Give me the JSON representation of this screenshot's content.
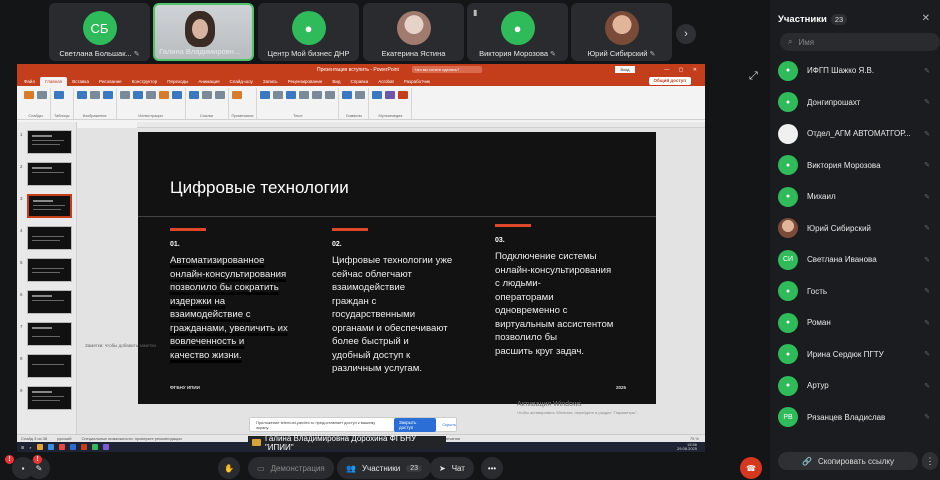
{
  "tiles": [
    {
      "initials": "СБ",
      "name": "Светлана Большак...",
      "muted": true
    },
    {
      "initials": "",
      "name": "Галина Владимировн...",
      "muted": true,
      "video": true
    },
    {
      "initials": "",
      "name": "Центр Мой бизнес ДНР",
      "muted": false
    },
    {
      "initials": "",
      "name": "Екатерина Ястина",
      "muted": false
    },
    {
      "initials": "",
      "name": "Виктория Морозова",
      "muted": true
    },
    {
      "initials": "",
      "name": "Юрий Сибирский",
      "muted": true
    }
  ],
  "icons": {
    "mute": "✎",
    "next": "›",
    "expand": "⤢"
  },
  "ppt": {
    "title": "Презентация вступить - PowerPoint",
    "search": "Что вы хотите сделать?",
    "login": "Вход",
    "tabs": [
      "Файл",
      "Главная",
      "Вставка",
      "Рисование",
      "Конструктор",
      "Переходы",
      "Анимация",
      "Слайд-шоу",
      "Запись",
      "Рецензирование",
      "Вид",
      "Справка",
      "Acrobat",
      "Разработчик"
    ],
    "active_tab": "Вставка",
    "share_btn": "Общий доступ",
    "groups": [
      "Слайды",
      "Таблицы",
      "Изображения",
      "Иллюстрации",
      "Ссылки",
      "Примечания",
      "Текст",
      "Символы",
      "Мультимедиа"
    ],
    "notes": "Заметки: чтобы добавить заметки",
    "status_left": "Слайд 3 из 38",
    "status_lang": "русский",
    "status_access": "Специальные возможности: проверьте рекомендации",
    "status_notes": "Заметки",
    "status_comments": "Примечания",
    "zoom": "75 %",
    "clock_time": "15:56",
    "clock_date": "29.08.2025",
    "popup_text": "Приложение telemost.yandex.ru предоставляет доступ к вашему экрану.",
    "popup_button": "Закрыть доступ",
    "popup_link": "Скрыть",
    "activation": "Активация Windows",
    "activation_sub": "Чтобы активировать Windows, перейдите в раздел \"Параметры\"."
  },
  "slide": {
    "title": "Цифровые технологии",
    "columns": [
      {
        "num": "01.",
        "text": "Автоматизированное\nонлайн-консультирования\nпозволило бы сократить\nиздержки на\nвзаимодействие с\nгражданами, увеличить их\nвовлеченность и\nкачество жизни."
      },
      {
        "num": "02.",
        "text": "Цифровые технологии уже\nсейчас облегчают\nвзаимодействие\nграждан с\nгосударственными\nорганами и обеспечивают\nболее быстрый и\nудобный доступ к\nразличным услугам."
      },
      {
        "num": "03.",
        "text": "Подключение системы\nонлайн-консультирования\nс людьми-\nоператорами\nодновременно с\nвиртуальным ассистентом\nпозволило бы\nрасшить круг задач."
      }
    ],
    "footer_left": "ФГБНУ ИПИИ",
    "footer_right": "2025"
  },
  "presenter": "Галина Владимировна Дорохина ФГБНУ \"ИПИИ\"",
  "controls": {
    "demo": "Демонстрация",
    "participants": "Участники",
    "participants_count": "23",
    "chat": "Чат",
    "more": "•••",
    "alert1": "!",
    "alert2": "!"
  },
  "sidebar": {
    "title": "Участники",
    "count": "23",
    "search_placeholder": "Имя",
    "participants": [
      {
        "name": "ИФГП Шажко Я.В.",
        "initials": "",
        "type": "green"
      },
      {
        "name": "Донгипрошахт",
        "initials": "",
        "type": "green"
      },
      {
        "name": "Отдел_АГМ АВТОМАТГОР...",
        "initials": "",
        "type": "logo"
      },
      {
        "name": "Виктория Морозова",
        "initials": "",
        "type": "green"
      },
      {
        "name": "Михаил",
        "initials": "",
        "type": "green"
      },
      {
        "name": "Юрий Сибирский",
        "initials": "",
        "type": "photo"
      },
      {
        "name": "Светлана Иванова",
        "initials": "СИ",
        "type": "green"
      },
      {
        "name": "Гость",
        "initials": "",
        "type": "green"
      },
      {
        "name": "Роман",
        "initials": "",
        "type": "green"
      },
      {
        "name": "Ирина Сердюк ПГТУ",
        "initials": "",
        "type": "green"
      },
      {
        "name": "Артур",
        "initials": "",
        "type": "green"
      },
      {
        "name": "Рязанцев Владислав",
        "initials": "РВ",
        "type": "green"
      }
    ],
    "copy_link": "Скопировать ссылку"
  },
  "colors": {
    "accent": "#2fbb5a",
    "ppt_red": "#c43e1c",
    "slide_bar": "#e0482a",
    "end_call": "#d6371f"
  }
}
